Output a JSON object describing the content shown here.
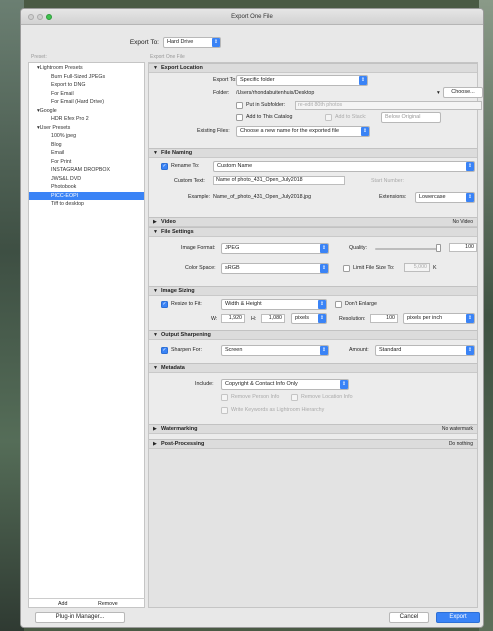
{
  "window": {
    "title": "Export One File"
  },
  "export_to": {
    "label": "Export To:",
    "value": "Hard Drive"
  },
  "columns": {
    "preset": "Preset:",
    "export_one_file": "Export One File"
  },
  "presets": [
    {
      "label": "▾Lightroom Presets",
      "type": "grp"
    },
    {
      "label": "Burn Full-Sized JPEGs",
      "type": "sub"
    },
    {
      "label": "Export to DNG",
      "type": "sub"
    },
    {
      "label": "For Email",
      "type": "sub"
    },
    {
      "label": "For Email (Hard Drive)",
      "type": "sub"
    },
    {
      "label": "▾Google",
      "type": "grp"
    },
    {
      "label": "HDR Efex Pro 2",
      "type": "sub"
    },
    {
      "label": "▾User Presets",
      "type": "grp"
    },
    {
      "label": "100% jpeg",
      "type": "sub"
    },
    {
      "label": "Blog",
      "type": "sub"
    },
    {
      "label": "Email",
      "type": "sub"
    },
    {
      "label": "For Print",
      "type": "sub"
    },
    {
      "label": "INSTAGRAM DROPBOX",
      "type": "sub"
    },
    {
      "label": "JWS&L DVD",
      "type": "sub"
    },
    {
      "label": "Photobook",
      "type": "sub"
    },
    {
      "label": "PICC-EOPI",
      "type": "sub",
      "selected": true
    },
    {
      "label": "Tiff to desktop",
      "type": "sub"
    }
  ],
  "left_buttons": {
    "add": "Add",
    "remove": "Remove"
  },
  "export_location": {
    "title": "Export Location",
    "export_to_label": "Export To:",
    "export_to_value": "Specific folder",
    "folder_label": "Folder:",
    "folder_value": "/Users/rhondabuitenhuis/Desktop",
    "choose": "Choose...",
    "subfolder_label": "Put in Subfolder:",
    "subfolder_value": "re-edit 80th photos",
    "catalog_label": "Add to This Catalog",
    "stack_label": "Add to Stack:",
    "stack_value": "Below Original",
    "existing_label": "Existing Files:",
    "existing_value": "Choose a new name for the exported file"
  },
  "file_naming": {
    "title": "File Naming",
    "rename_label": "Rename To:",
    "rename_value": "Custom Name",
    "custom_label": "Custom Text:",
    "custom_value": "Name of photo_431_Open_July2018",
    "start_label": "Start Number:",
    "example_label": "Example:",
    "example_value": "Name_of_photo_431_Open_July2018.jpg",
    "ext_label": "Extensions:",
    "ext_value": "Lowercase"
  },
  "video": {
    "title": "Video",
    "right": "No Video"
  },
  "file_settings": {
    "title": "File Settings",
    "format_label": "Image Format:",
    "format_value": "JPEG",
    "quality_label": "Quality:",
    "quality_value": "100",
    "quality_fraction": 1.0,
    "color_label": "Color Space:",
    "color_value": "sRGB",
    "limit_label": "Limit File Size To:",
    "limit_value": "5,000",
    "limit_unit": "K"
  },
  "image_sizing": {
    "title": "Image Sizing",
    "resize_label": "Resize to Fit:",
    "resize_value": "Width & Height",
    "enlarge_label": "Don't Enlarge",
    "w_label": "W:",
    "w_value": "1,920",
    "h_label": "H:",
    "h_value": "1,080",
    "unit_value": "pixels",
    "res_label": "Resolution:",
    "res_value": "100",
    "res_unit": "pixels per inch"
  },
  "sharpening": {
    "title": "Output Sharpening",
    "sharpen_label": "Sharpen For:",
    "sharpen_value": "Screen",
    "amount_label": "Amount:",
    "amount_value": "Standard"
  },
  "metadata": {
    "title": "Metadata",
    "include_label": "Include:",
    "include_value": "Copyright & Contact Info Only",
    "remove_person": "Remove Person Info",
    "remove_location": "Remove Location Info",
    "keywords": "Write Keywords as Lightroom Hierarchy"
  },
  "watermarking": {
    "title": "Watermarking",
    "right": "No watermark"
  },
  "post": {
    "title": "Post-Processing",
    "right": "Do nothing"
  },
  "footer": {
    "plugin": "Plug-in Manager...",
    "cancel": "Cancel",
    "export": "Export"
  },
  "colors": {
    "accent": "#3a83f6"
  }
}
